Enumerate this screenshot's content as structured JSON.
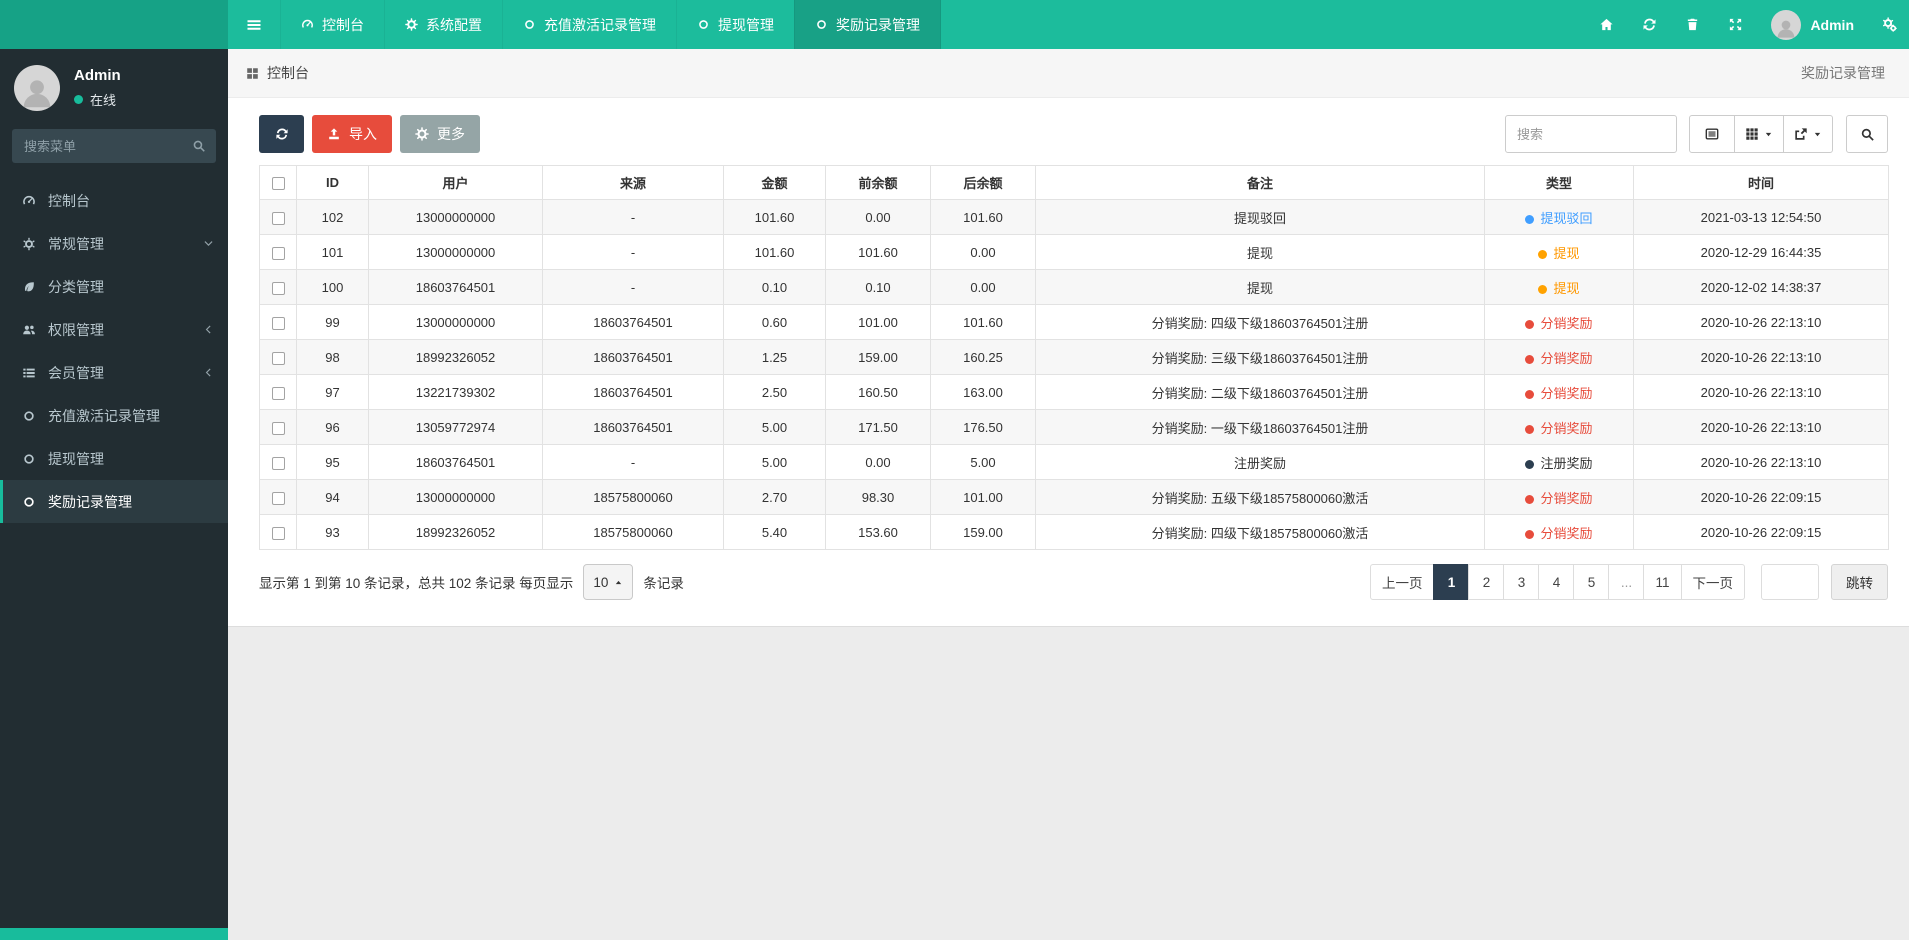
{
  "palette": {
    "teal": "#18bc9c",
    "navy": "#2c3e50",
    "red": "#e74c3c",
    "gray": "#95a5a6"
  },
  "navbar": {
    "tabs": [
      {
        "label": "控制台",
        "icon": "dashboard-icon",
        "active": false
      },
      {
        "label": "系统配置",
        "icon": "gear-icon",
        "active": false
      },
      {
        "label": "充值激活记录管理",
        "icon": "circle-icon",
        "active": false
      },
      {
        "label": "提现管理",
        "icon": "circle-icon",
        "active": false
      },
      {
        "label": "奖励记录管理",
        "icon": "circle-icon",
        "active": true
      }
    ],
    "actions": [
      "home-icon",
      "refresh-icon",
      "trash-icon",
      "expand-icon"
    ],
    "user_name": "Admin"
  },
  "sidebar": {
    "user": {
      "name": "Admin",
      "status": "在线"
    },
    "search_placeholder": "搜索菜单",
    "items": [
      {
        "label": "控制台",
        "icon": "dashboard-icon",
        "arrow": "",
        "active": false
      },
      {
        "label": "常规管理",
        "icon": "cogs-icon",
        "arrow": "down",
        "active": false
      },
      {
        "label": "分类管理",
        "icon": "leaf-icon",
        "arrow": "",
        "active": false
      },
      {
        "label": "权限管理",
        "icon": "users-icon",
        "arrow": "left",
        "active": false
      },
      {
        "label": "会员管理",
        "icon": "list-icon",
        "arrow": "left",
        "active": false
      },
      {
        "label": "充值激活记录管理",
        "icon": "circle-icon",
        "arrow": "",
        "active": false
      },
      {
        "label": "提现管理",
        "icon": "circle-icon",
        "arrow": "",
        "active": false
      },
      {
        "label": "奖励记录管理",
        "icon": "circle-icon",
        "arrow": "",
        "active": true
      }
    ]
  },
  "breadcrumb": {
    "home_label": "控制台",
    "page_label": "奖励记录管理"
  },
  "toolbar": {
    "import_label": "导入",
    "more_label": "更多",
    "search_placeholder": "搜索",
    "view_buttons": [
      {
        "icon": "list-alt-icon",
        "caret": false
      },
      {
        "icon": "grid-icon",
        "caret": true
      },
      {
        "icon": "export-icon",
        "caret": true
      }
    ]
  },
  "table": {
    "columns": [
      "ID",
      "用户",
      "来源",
      "金额",
      "前余额",
      "后余额",
      "备注",
      "类型",
      "时间"
    ],
    "type_styles": {
      "blue": {
        "dot": "#409eff",
        "text": "#409eff"
      },
      "orange": {
        "dot": "#ffa200",
        "text": "#ff9800"
      },
      "red": {
        "dot": "#e74c3c",
        "text": "#e74c3c"
      },
      "dark": {
        "dot": "#2c3e50",
        "text": "#333333"
      }
    },
    "rows": [
      {
        "id": "102",
        "user": "13000000000",
        "source": "-",
        "amount": "101.60",
        "before": "0.00",
        "after": "101.60",
        "remark": "提现驳回",
        "type": "提现驳回",
        "type_style": "blue",
        "time": "2021-03-13 12:54:50"
      },
      {
        "id": "101",
        "user": "13000000000",
        "source": "-",
        "amount": "101.60",
        "before": "101.60",
        "after": "0.00",
        "remark": "提现",
        "type": "提现",
        "type_style": "orange",
        "time": "2020-12-29 16:44:35"
      },
      {
        "id": "100",
        "user": "18603764501",
        "source": "-",
        "amount": "0.10",
        "before": "0.10",
        "after": "0.00",
        "remark": "提现",
        "type": "提现",
        "type_style": "orange",
        "time": "2020-12-02 14:38:37"
      },
      {
        "id": "99",
        "user": "13000000000",
        "source": "18603764501",
        "amount": "0.60",
        "before": "101.00",
        "after": "101.60",
        "remark": "分销奖励: 四级下级18603764501注册",
        "type": "分销奖励",
        "type_style": "red",
        "time": "2020-10-26 22:13:10"
      },
      {
        "id": "98",
        "user": "18992326052",
        "source": "18603764501",
        "amount": "1.25",
        "before": "159.00",
        "after": "160.25",
        "remark": "分销奖励: 三级下级18603764501注册",
        "type": "分销奖励",
        "type_style": "red",
        "time": "2020-10-26 22:13:10"
      },
      {
        "id": "97",
        "user": "13221739302",
        "source": "18603764501",
        "amount": "2.50",
        "before": "160.50",
        "after": "163.00",
        "remark": "分销奖励: 二级下级18603764501注册",
        "type": "分销奖励",
        "type_style": "red",
        "time": "2020-10-26 22:13:10"
      },
      {
        "id": "96",
        "user": "13059772974",
        "source": "18603764501",
        "amount": "5.00",
        "before": "171.50",
        "after": "176.50",
        "remark": "分销奖励: 一级下级18603764501注册",
        "type": "分销奖励",
        "type_style": "red",
        "time": "2020-10-26 22:13:10"
      },
      {
        "id": "95",
        "user": "18603764501",
        "source": "-",
        "amount": "5.00",
        "before": "0.00",
        "after": "5.00",
        "remark": "注册奖励",
        "type": "注册奖励",
        "type_style": "dark",
        "time": "2020-10-26 22:13:10"
      },
      {
        "id": "94",
        "user": "13000000000",
        "source": "18575800060",
        "amount": "2.70",
        "before": "98.30",
        "after": "101.00",
        "remark": "分销奖励: 五级下级18575800060激活",
        "type": "分销奖励",
        "type_style": "red",
        "time": "2020-10-26 22:09:15"
      },
      {
        "id": "93",
        "user": "18992326052",
        "source": "18575800060",
        "amount": "5.40",
        "before": "153.60",
        "after": "159.00",
        "remark": "分销奖励: 四级下级18575800060激活",
        "type": "分销奖励",
        "type_style": "red",
        "time": "2020-10-26 22:09:15"
      }
    ]
  },
  "footer": {
    "summary": "显示第 1 到第 10 条记录，总共 102 条记录 每页显示",
    "page_size": "10",
    "records_suffix": "条记录",
    "pages": [
      {
        "label": "上一页",
        "active": false,
        "disabled": false
      },
      {
        "label": "1",
        "active": true,
        "disabled": false
      },
      {
        "label": "2",
        "active": false,
        "disabled": false
      },
      {
        "label": "3",
        "active": false,
        "disabled": false
      },
      {
        "label": "4",
        "active": false,
        "disabled": false
      },
      {
        "label": "5",
        "active": false,
        "disabled": false
      },
      {
        "label": "...",
        "active": false,
        "disabled": true
      },
      {
        "label": "11",
        "active": false,
        "disabled": false
      },
      {
        "label": "下一页",
        "active": false,
        "disabled": false
      }
    ],
    "jump_label": "跳转"
  }
}
